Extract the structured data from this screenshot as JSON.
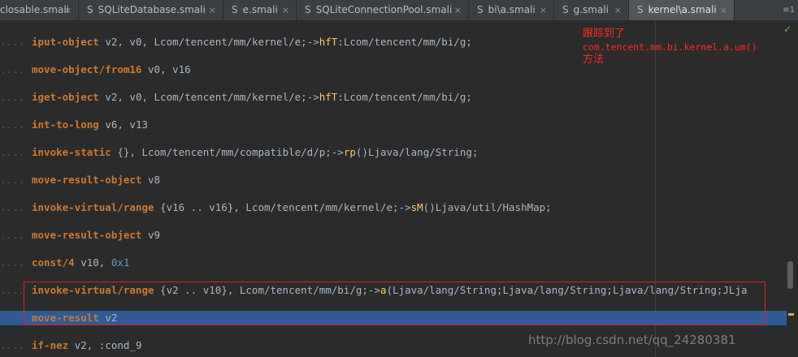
{
  "tabs": [
    {
      "label": "closable.smali",
      "active": false,
      "icon": "smali-file-icon"
    },
    {
      "label": "SQLiteDatabase.smali",
      "active": false,
      "icon": "smali-file-icon"
    },
    {
      "label": "e.smali",
      "active": false,
      "icon": "smali-file-icon"
    },
    {
      "label": "SQLiteConnectionPool.smali",
      "active": false,
      "icon": "smali-file-icon"
    },
    {
      "label": "bi\\a.smali",
      "active": false,
      "icon": "smali-file-icon"
    },
    {
      "label": "g.smali",
      "active": false,
      "icon": "smali-file-icon"
    },
    {
      "label": "kernel\\a.smali",
      "active": true,
      "icon": "smali-file-icon"
    }
  ],
  "tab_icon_glyph": "S",
  "tab_close_glyph": "×",
  "tab_menu_glyph": "≡1",
  "code": {
    "indent": "....",
    "lines": [
      {
        "op": "iput-object",
        "rest": " v2, v0, ",
        "type": "Lcom/tencent/mm/kernel/e;->",
        "fn": "hfT",
        "tail": ":Lcom/tencent/mm/bi/g;"
      },
      {
        "op": "move-object/from16",
        "rest": " v0, v16",
        "type": "",
        "fn": "",
        "tail": ""
      },
      {
        "op": "iget-object",
        "rest": " v2, v0, ",
        "type": "Lcom/tencent/mm/kernel/e;->",
        "fn": "hfT",
        "tail": ":Lcom/tencent/mm/bi/g;"
      },
      {
        "op": "int-to-long",
        "rest": " v6, v13",
        "type": "",
        "fn": "",
        "tail": ""
      },
      {
        "op": "invoke-static",
        "rest": " {}, ",
        "type": "Lcom/tencent/mm/compatible/d/p;->",
        "fn": "rp",
        "tail": "()Ljava/lang/String;"
      },
      {
        "op": "move-result-object",
        "rest": " v8",
        "type": "",
        "fn": "",
        "tail": ""
      },
      {
        "op": "invoke-virtual/range",
        "rest": " {v16 .. v16}, ",
        "type": "Lcom/tencent/mm/kernel/e;->",
        "fn": "sM",
        "tail": "()Ljava/util/HashMap;"
      },
      {
        "op": "move-result-object",
        "rest": " v9",
        "type": "",
        "fn": "",
        "tail": ""
      },
      {
        "op": "const/4",
        "rest": " v10, ",
        "type": "",
        "fn": "",
        "tail": "",
        "num": "0x1"
      },
      {
        "op": "invoke-virtual/range",
        "rest": " {v2 .. v10}, ",
        "type": "Lcom/tencent/mm/bi/g;->",
        "fn": "a",
        "tail": "(Ljava/lang/String;Ljava/lang/String;Ljava/lang/String;JLja"
      },
      {
        "op": "move-result",
        "rest": " v2",
        "type": "",
        "fn": "",
        "tail": "",
        "selected": true
      },
      {
        "op": "if-nez",
        "rest": " v2, :cond_9",
        "type": "",
        "fn": "",
        "tail": ""
      }
    ]
  },
  "annotation": {
    "line1": "跟踪到了",
    "line2": "com.tencent.mm.bi.kernel.a.um()",
    "line3": "方法"
  },
  "inspection_status": "✓",
  "watermark": "http://blog.csdn.net/qq_24280381",
  "colors": {
    "keyword": "#cc7832",
    "method": "#ffc66d",
    "number": "#6897bb",
    "selection": "#2f5a96",
    "annotation": "#ff2a2a"
  }
}
